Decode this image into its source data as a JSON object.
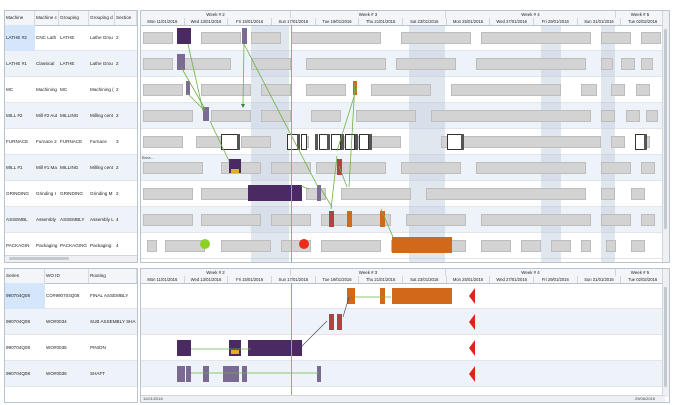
{
  "resources": {
    "headers": [
      "Machine",
      "Machine c",
      "Grouping",
      "Grouping d",
      "Section"
    ],
    "rows": [
      {
        "machine": "LATHE #2",
        "machine_desc": "CNC Lath",
        "grouping": "LATHE",
        "grouping_desc": "Lathe Grou",
        "section": "2"
      },
      {
        "machine": "LATHE #1",
        "machine_desc": "Classical",
        "grouping": "LATHE",
        "grouping_desc": "Lathe Grou",
        "section": "2"
      },
      {
        "machine": "MC",
        "machine_desc": "Machining",
        "grouping": "MC",
        "grouping_desc": "Machining (",
        "section": "2"
      },
      {
        "machine": "MILL #2",
        "machine_desc": "Mill #2 Aut",
        "grouping": "MILLING",
        "grouping_desc": "Milling cent",
        "section": "2"
      },
      {
        "machine": "FURNACE",
        "machine_desc": "Furnace 2",
        "grouping": "FURNACE",
        "grouping_desc": "Furnace",
        "section": "3"
      },
      {
        "machine": "MILL #1",
        "machine_desc": "Mill #1 Ma",
        "grouping": "MILLING",
        "grouping_desc": "Milling cent",
        "section": "2"
      },
      {
        "machine": "GRINDING",
        "machine_desc": "Grinding I",
        "grouping": "GRINDING",
        "grouping_desc": "Grinding M",
        "section": "2"
      },
      {
        "machine": "ASSEMBL",
        "machine_desc": "Assembly",
        "grouping": "ASSEMBLY",
        "grouping_desc": "Assembly L",
        "section": "4"
      },
      {
        "machine": "PACKAGIN",
        "machine_desc": "Packaging",
        "grouping": "PACKAGING",
        "grouping_desc": "Packaging",
        "section": "4"
      }
    ]
  },
  "orders": {
    "headers": [
      "Series",
      "WO ID",
      "Routing"
    ],
    "rows": [
      {
        "series": "990704Q08",
        "wo": "CO#990704Q08",
        "routing": "FINAL ASSEMBLY"
      },
      {
        "series": "990704Q08",
        "wo": "WO#0034",
        "routing": "SUB ASSEMBLY SHA"
      },
      {
        "series": "990704Q08",
        "wo": "WO#0035",
        "routing": "PINION"
      },
      {
        "series": "990704Q08",
        "wo": "WO#0036",
        "routing": "SHAFT"
      }
    ]
  },
  "timeline": {
    "weeks": [
      "Week # 2",
      "Week # 3",
      "Week # 4",
      "Week # 5"
    ],
    "days": [
      "Mon 11/01/2016",
      "Wed 13/01/2016",
      "Fri 15/01/2016",
      "Sun 17/01/2016",
      "Tue 19/01/2016",
      "Thu 21/01/2016",
      "Sat 23/01/2016",
      "Mon 25/01/2016",
      "Wed 27/01/2016",
      "Fri 29/01/2016",
      "Sun 31/01/2016",
      "Tue 02/02/2016"
    ]
  },
  "labels": {
    "brea": "Brea...",
    "scroll_start": "11/01/2016",
    "scroll_end": "29/06/2016"
  },
  "colors": {
    "purple": "#4b2a63",
    "orange": "#d06a1a",
    "red": "#b24045",
    "green_line": "#7fbf5f",
    "gray_slot": "#d3d3d3"
  }
}
